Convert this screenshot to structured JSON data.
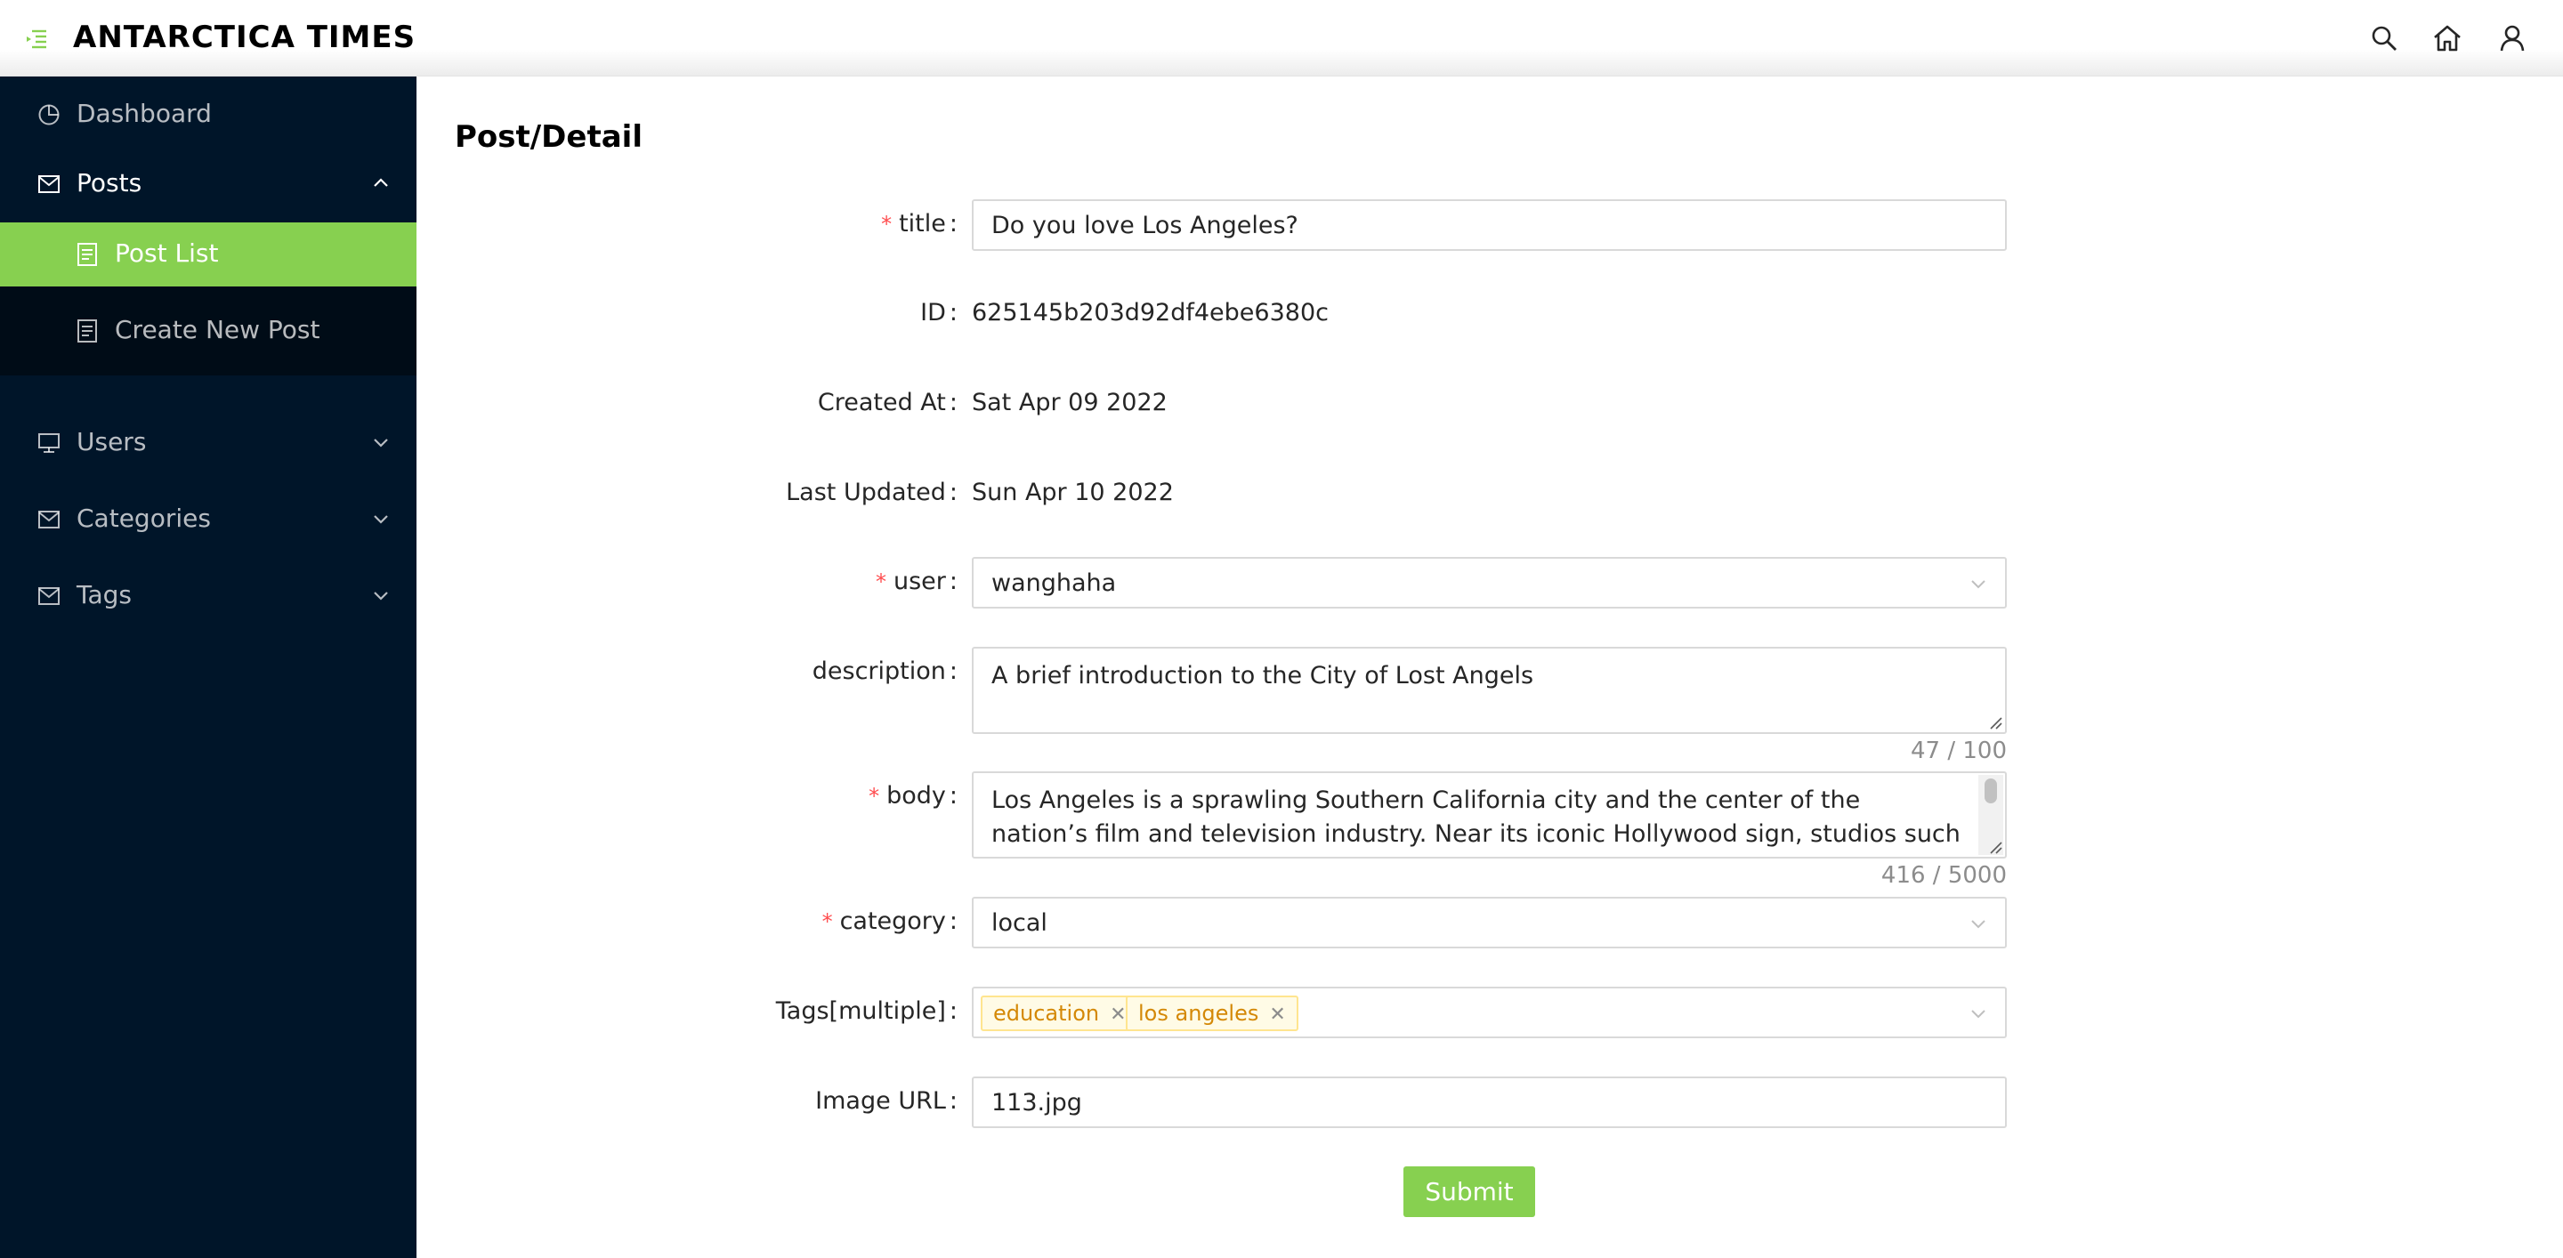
{
  "header": {
    "title": "ANTARCTICA TIMES",
    "icons": [
      "menu-fold-icon",
      "search-icon",
      "home-icon",
      "user-icon"
    ],
    "accent": "#87d050"
  },
  "sidebar": {
    "background": "#001529",
    "items": [
      {
        "label": "Dashboard",
        "icon": "pie-chart-icon"
      },
      {
        "label": "Posts",
        "icon": "mail-icon",
        "expanded": true,
        "children": [
          {
            "label": "Post List",
            "icon": "file-icon",
            "active": true
          },
          {
            "label": "Create New Post",
            "icon": "file-icon"
          }
        ]
      },
      {
        "label": "Users",
        "icon": "desktop-icon"
      },
      {
        "label": "Categories",
        "icon": "mail-icon"
      },
      {
        "label": "Tags",
        "icon": "mail-icon"
      }
    ]
  },
  "main": {
    "title": "Post/Detail",
    "form": {
      "title": {
        "label": "title",
        "required": true,
        "value": "Do you love Los Angeles?"
      },
      "id": {
        "label": "ID",
        "value": "625145b203d92df4ebe6380c"
      },
      "created": {
        "label": "Created At",
        "value": "Sat Apr 09 2022"
      },
      "updated": {
        "label": "Last Updated",
        "value": "Sun Apr 10 2022"
      },
      "user": {
        "label": "user",
        "required": true,
        "value": "wanghaha"
      },
      "description": {
        "label": "description",
        "value": "A brief introduction to the City of Lost Angels",
        "count": "47 / 100"
      },
      "body": {
        "label": "body",
        "required": true,
        "value": "Los Angeles is a sprawling Southern California city and the center of the nation’s film and television industry. Near its iconic Hollywood sign, studios such as Paramount",
        "count": "416 / 5000"
      },
      "category": {
        "label": "category",
        "required": true,
        "value": "local"
      },
      "tags": {
        "label": "Tags[multiple]",
        "values": [
          "education",
          "los angeles"
        ]
      },
      "image": {
        "label": "Image URL",
        "value": "113.jpg"
      },
      "submit_label": "Submit"
    }
  }
}
